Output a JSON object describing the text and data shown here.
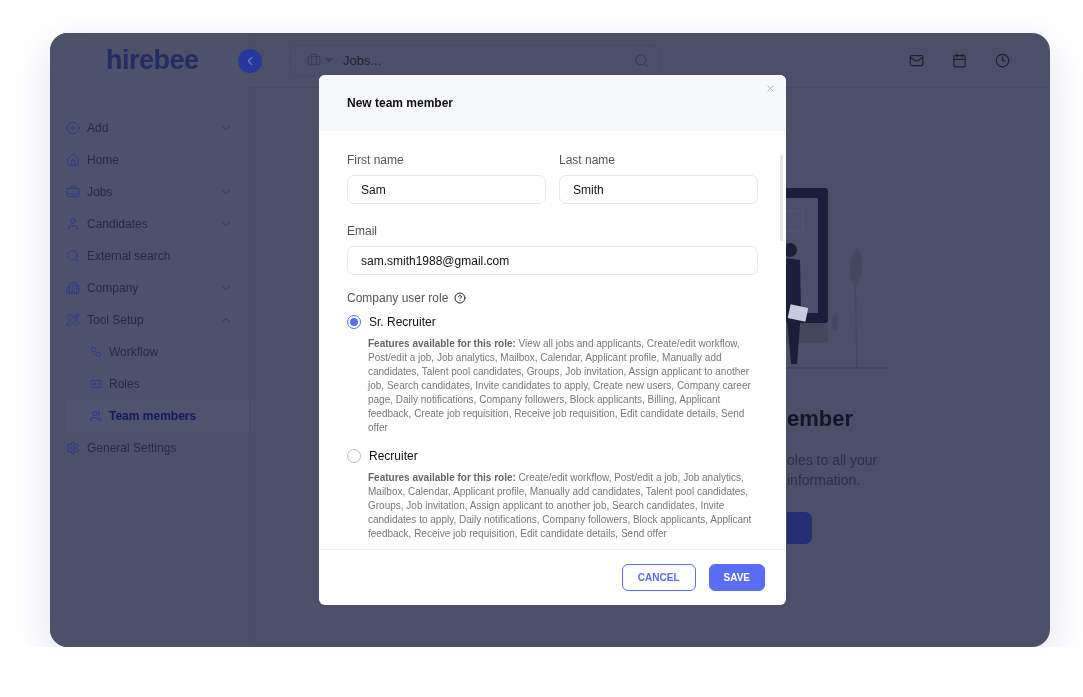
{
  "logo": "hirebee",
  "sidebar": {
    "items": [
      {
        "label": "Add",
        "kind": "group",
        "expanded": false
      },
      {
        "label": "Home",
        "kind": "link"
      },
      {
        "label": "Jobs",
        "kind": "group",
        "expanded": false
      },
      {
        "label": "Candidates",
        "kind": "group",
        "expanded": false
      },
      {
        "label": "External search",
        "kind": "link"
      },
      {
        "label": "Company",
        "kind": "group",
        "expanded": false
      },
      {
        "label": "Tool Setup",
        "kind": "group",
        "expanded": true,
        "children": [
          {
            "label": "Workflow",
            "selected": false
          },
          {
            "label": "Roles",
            "selected": false
          },
          {
            "label": "Team members",
            "selected": true
          }
        ]
      },
      {
        "label": "General Settings",
        "kind": "link"
      }
    ]
  },
  "topbar": {
    "search": {
      "placeholder": "Jobs..."
    }
  },
  "background": {
    "heading": "ember",
    "lines": [
      "oles to all your",
      "information."
    ]
  },
  "modal": {
    "title": "New team member",
    "name_fields": [
      {
        "label": "First name",
        "value": "Sam"
      },
      {
        "label": "Last name",
        "value": "Smith"
      }
    ],
    "email": {
      "label": "Email",
      "value": "sam.smith1988@gmail.com"
    },
    "role_label": "Company user role",
    "roles": [
      {
        "name": "Sr. Recruiter",
        "selected": true,
        "features": "**Features available for this role:** View all jobs and applicants, Create/edit workflow, Post/edit a job, Job analytics, Mailbox, Calendar, Applicant profile, Manually add candidates, Talent pool candidates, Groups, Job invitation, Assign applicant to another job, Search candidates, Invite candidates to apply, Create new users, Company career page, Daily notifications, Company followers, Block applicants, Billing, Applicant feedback, Create job requisition, Receive job requisition, Edit candidate details, Send offer"
      },
      {
        "name": "Recruiter",
        "selected": false,
        "features": "**Features available for this role:** Create/edit workflow, Post/edit a job, Job analytics, Mailbox, Calendar, Applicant profile, Manually add candidates, Talent pool candidates, Groups, Job invitation, Assign applicant to another job, Search candidates, Invite candidates to apply, Daily notifications, Company followers, Block applicants, Applicant feedback, Receive job requisition, Edit candidate details, Send offer"
      }
    ],
    "buttons": {
      "cancel": "CANCEL",
      "save": "SAVE"
    }
  }
}
